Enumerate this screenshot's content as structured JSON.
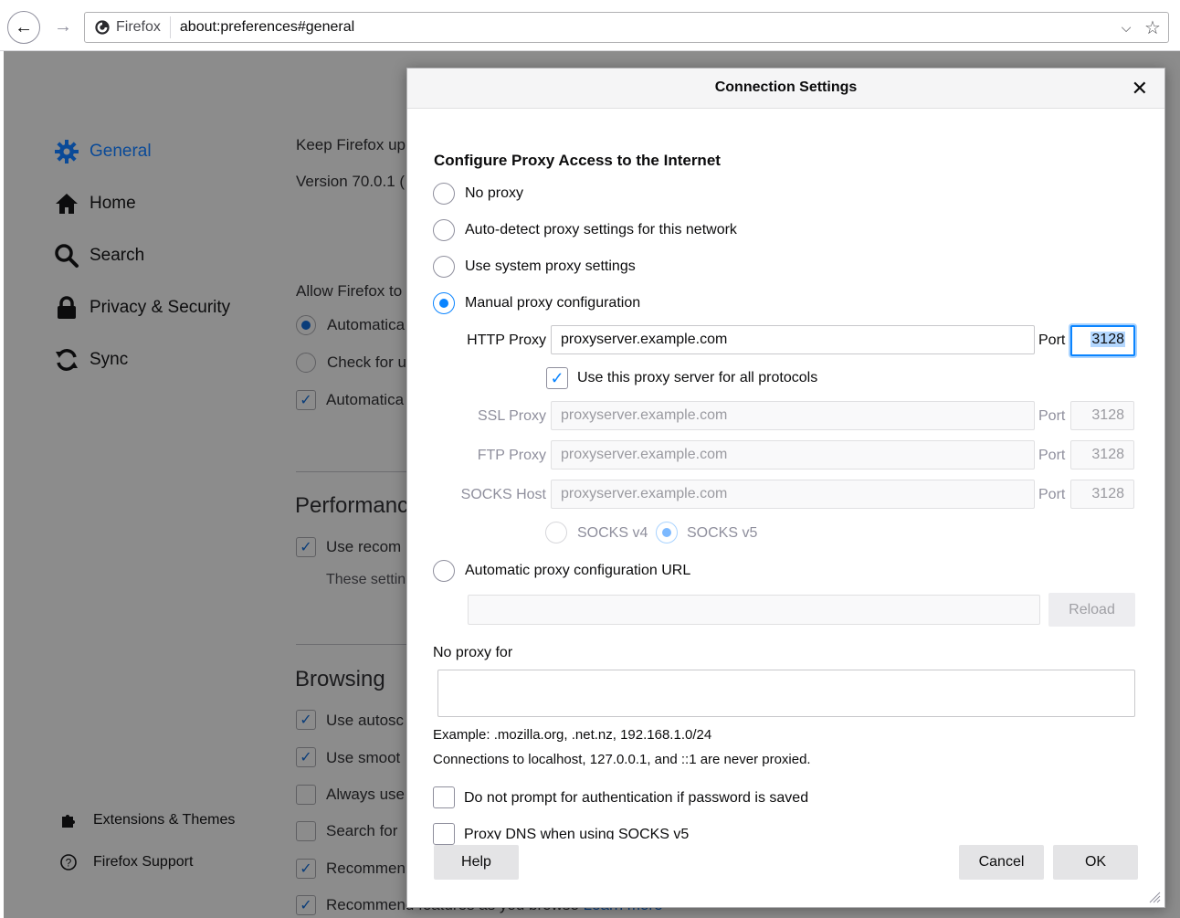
{
  "browser": {
    "back_icon": "←",
    "forward_icon": "→",
    "identity_label": "Firefox",
    "url": "about:preferences#general",
    "dropdown_icon": "⌵",
    "bookmark_icon": "☆"
  },
  "sidebar": {
    "items": [
      {
        "label": "General",
        "icon": "gear-icon"
      },
      {
        "label": "Home",
        "icon": "home-icon"
      },
      {
        "label": "Search",
        "icon": "search-icon"
      },
      {
        "label": "Privacy & Security",
        "icon": "lock-icon"
      },
      {
        "label": "Sync",
        "icon": "sync-icon"
      }
    ],
    "footer": [
      {
        "label": "Extensions & Themes",
        "icon": "puzzle-icon"
      },
      {
        "label": "Firefox Support",
        "icon": "help-icon"
      }
    ]
  },
  "background_page": {
    "update_line": "Keep Firefox up",
    "version_line": "Version 70.0.1 (",
    "allow_line": "Allow Firefox to",
    "update_options": [
      "Automatica",
      "Check for u",
      "Automatica"
    ],
    "performance_heading": "Performance",
    "performance_option": "Use recom",
    "performance_note": "These settin",
    "browsing_heading": "Browsing",
    "browsing_options": [
      "Use autosc",
      "Use smoot",
      "Always use",
      "Search for",
      "Recommen",
      "Recommend features as you browse"
    ],
    "learn_more": "Learn more"
  },
  "dialog": {
    "title": "Connection Settings",
    "close_icon": "✕",
    "heading": "Configure Proxy Access to the Internet",
    "options": {
      "no_proxy": "No proxy",
      "auto_detect": "Auto-detect proxy settings for this network",
      "system": "Use system proxy settings",
      "manual": "Manual proxy configuration",
      "auto_url": "Automatic proxy configuration URL"
    },
    "selected_option": "manual",
    "http_proxy": {
      "label": "HTTP Proxy",
      "value": "proxyserver.example.com",
      "port_label": "Port",
      "port": "3128"
    },
    "share_all": {
      "label": "Use this proxy server for all protocols",
      "checked": true
    },
    "ssl_proxy": {
      "label": "SSL Proxy",
      "value": "proxyserver.example.com",
      "port_label": "Port",
      "port": "3128"
    },
    "ftp_proxy": {
      "label": "FTP Proxy",
      "value": "proxyserver.example.com",
      "port_label": "Port",
      "port": "3128"
    },
    "socks_host": {
      "label": "SOCKS Host",
      "value": "proxyserver.example.com",
      "port_label": "Port",
      "port": "3128"
    },
    "socks_v4": "SOCKS v4",
    "socks_v5": "SOCKS v5",
    "autoconfig_url": "",
    "reload_label": "Reload",
    "no_proxy_for_label": "No proxy for",
    "no_proxy_for_value": "",
    "example_text": "Example: .mozilla.org, .net.nz, 192.168.1.0/24",
    "localhost_text": "Connections to localhost, 127.0.0.1, and ::1 are never proxied.",
    "no_prompt_auth": "Do not prompt for authentication if password is saved",
    "proxy_dns": "Proxy DNS when using SOCKS v5",
    "help_label": "Help",
    "cancel_label": "Cancel",
    "ok_label": "OK"
  },
  "colors": {
    "accent": "#0a84ff",
    "overlay_page": "#8c8c8c",
    "active_sidebar": "#0a4a98"
  }
}
